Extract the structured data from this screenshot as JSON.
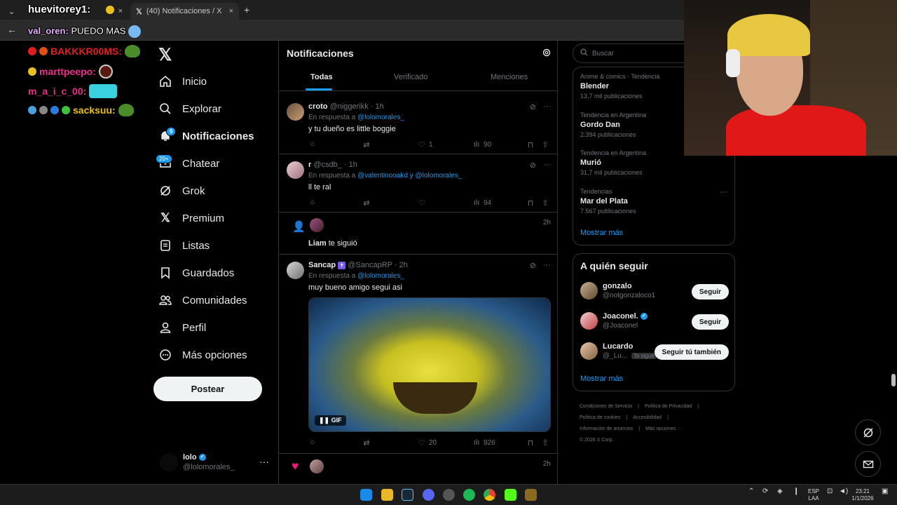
{
  "browser": {
    "tabs": [
      {
        "label": "huevitorey1:"
      },
      {
        "label": "(40) Notificaciones / X"
      }
    ],
    "new_tab": "+",
    "close": "×"
  },
  "overlay": {
    "top_user": "huevitorey1:",
    "second_user": "val_oren:",
    "second_msg": "PUEDO MAS",
    "lines": [
      {
        "user": "BAKKKR00MS:",
        "color": "#e02020"
      },
      {
        "user": "marttpeepo:",
        "color": "#e8308a"
      },
      {
        "user": "m_a_i_c_00:",
        "color": "#e8308a"
      },
      {
        "user": "sacksuu:",
        "color": "#e8c020"
      }
    ]
  },
  "nav": {
    "logo": "X",
    "items": [
      {
        "label": "Inicio",
        "icon": "home-icon"
      },
      {
        "label": "Explorar",
        "icon": "search-icon"
      },
      {
        "label": "Notificaciones",
        "icon": "bell-icon",
        "badge": "9"
      },
      {
        "label": "Chatear",
        "icon": "mail-icon",
        "badge": "20+"
      },
      {
        "label": "Grok",
        "icon": "grok-icon"
      },
      {
        "label": "Premium",
        "icon": "x-icon"
      },
      {
        "label": "Listas",
        "icon": "list-icon"
      },
      {
        "label": "Guardados",
        "icon": "bookmark-icon"
      },
      {
        "label": "Comunidades",
        "icon": "people-icon"
      },
      {
        "label": "Perfil",
        "icon": "person-icon"
      },
      {
        "label": "Más opciones",
        "icon": "more-circle-icon"
      }
    ],
    "post_button": "Postear",
    "me": {
      "name": "lolo",
      "handle": "@lolomorales_",
      "more": "···"
    }
  },
  "center": {
    "title": "Notificaciones",
    "tabs": [
      "Todas",
      "Verificado",
      "Menciones"
    ],
    "posts": [
      {
        "name": "croto",
        "handle": "@niggerikk",
        "time": "· 1h",
        "reply_prefix": "En respuesta a",
        "reply_to": "@lolomorales_",
        "text": "y tu dueño es little boggie",
        "likes": "1",
        "views": "90"
      },
      {
        "name": "r",
        "handle": "@csdb_",
        "time": "· 1h",
        "reply_prefix": "En respuesta a",
        "reply_to": "@valentinooakd y @lolomorales_",
        "text": "ll te ral",
        "likes": "",
        "views": "94"
      },
      {
        "follow_text_name": "Liam",
        "follow_text": "te siguió",
        "time": "2h"
      },
      {
        "name": "Sancap",
        "handle": "@SancapRP",
        "time": "· 2h",
        "reply_prefix": "En respuesta a",
        "reply_to": "@lolomorales_",
        "text": "muy bueno amigo segui asi",
        "gif_label": "GIF",
        "likes": "20",
        "views": "926"
      },
      {
        "time": "2h"
      }
    ]
  },
  "right": {
    "search_placeholder": "Buscar",
    "trends": [
      {
        "context": "Anime & comics · Tendencia",
        "name": "Blender",
        "count": "13,7 mil publicaciones"
      },
      {
        "context": "Tendencia en Argentina",
        "name": "Gordo Dan",
        "count": "2.394 publicaciones"
      },
      {
        "context": "Tendencia en Argentina",
        "name": "Murió",
        "count": "31,7 mil publicaciones"
      },
      {
        "context": "Tendencias",
        "name": "Mar del Plata",
        "count": "7.567 publicaciones"
      }
    ],
    "show_more": "Mostrar más",
    "who_to_follow": {
      "title": "A quién seguir",
      "users": [
        {
          "name": "gonzalo",
          "handle": "@notgonzaloco1",
          "button": "Seguir"
        },
        {
          "name": "Joaconel.",
          "handle": "@Joaconel",
          "button": "Seguir"
        },
        {
          "name": "Lucardo",
          "handle": "@_Lu...",
          "follows_you": "Te sigue",
          "button": "Seguir tú también"
        }
      ],
      "show_more": "Mostrar más"
    },
    "footer": [
      "Condiciones de Servicio",
      "Política de Privacidad",
      "Política de cookies",
      "Accesibilidad",
      "Información de anuncios",
      "Más opciones ···",
      "© 2026 X Corp."
    ]
  },
  "taskbar": {
    "lang_top": "ESP",
    "lang_bottom": "LAA",
    "time": "23:21",
    "date": "1/1/2026"
  }
}
